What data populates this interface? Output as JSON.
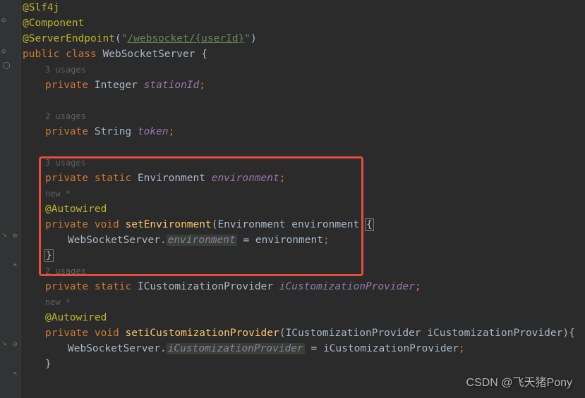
{
  "code": {
    "line0_faded": "",
    "anno_slf4j": "@Slf4j",
    "anno_component": "@Component",
    "anno_serverendpoint_pre": "@ServerEndpoint",
    "anno_serverendpoint_paren1": "(",
    "anno_serverendpoint_q1": "\"",
    "anno_serverendpoint_url": "/websocket/{userId}",
    "anno_serverendpoint_q2": "\"",
    "anno_serverendpoint_paren2": ")",
    "kw_public": "public ",
    "kw_class": "class ",
    "classname": "WebSocketServer ",
    "brace_open": "{",
    "usages3": "3 usages",
    "kw_private": "private ",
    "type_integer": "Integer ",
    "field_stationid": "stationId",
    "semi": ";",
    "usages2": "2 usages",
    "type_string": "String ",
    "field_token": "token",
    "usages3b": "3 usages",
    "kw_static": "static ",
    "type_env": "Environment ",
    "field_env": "environment",
    "newstar": "new *",
    "anno_autowired": "@Autowired",
    "kw_void": "void ",
    "method_setenv": "setEnvironment",
    "paren_open": "(",
    "param_env_type": "Environment ",
    "param_env_name": "environment",
    "paren_close_brace": ")",
    "class_ref": "WebSocketServer.",
    "static_env": "environment",
    "assign": " = ",
    "arg_env": "environment",
    "brace_close": "}",
    "usages2b": "2 usages",
    "type_icust": "ICustomizationProvider ",
    "field_icust": "iCustomizationProvider",
    "method_seticust": "setiCustomizationProvider",
    "param_icust_type": "ICustomizationProvider ",
    "param_icust_name": "iCustomizationProvider",
    "static_icust": "iCustomizationProvider",
    "arg_icust": "iCustomizationProvider",
    "brace_open2": "{",
    "match_brace_open": "{",
    "match_brace_close": "}"
  },
  "watermark": "CSDN @飞天猪Pony"
}
